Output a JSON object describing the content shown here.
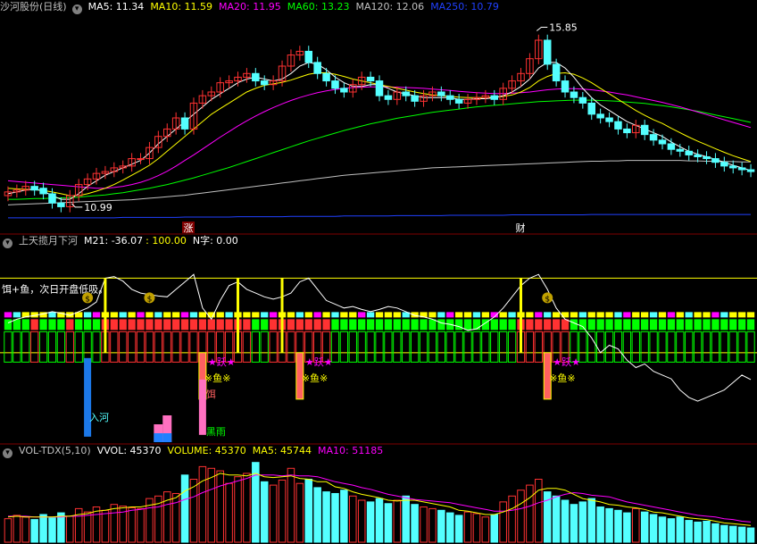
{
  "panel_main": {
    "title": "沙河股份(日线)",
    "ma": [
      {
        "label": "MA5: 11.34",
        "color": "#ffffff"
      },
      {
        "label": "MA10: 11.59",
        "color": "#ffff00"
      },
      {
        "label": "MA20: 11.95",
        "color": "#ff00ff"
      },
      {
        "label": "MA60: 13.23",
        "color": "#00ff00"
      },
      {
        "label": "MA120: 12.06",
        "color": "#c0c0c0"
      },
      {
        "label": "MA250: 10.79",
        "color": "#2040ff"
      }
    ],
    "high_label": "15.85",
    "low_label": "10.99",
    "marker1": "涨",
    "marker2": "财"
  },
  "panel_ind": {
    "title": "上天揽月下河",
    "m21": "M21: -36.07",
    "v100": ": 100.00",
    "nzi": "N字: 0.00",
    "note": "饵+鱼，次日开盘低吸。",
    "tag_enter": "入河",
    "tag_jump": "★跃★",
    "tag_fish": "※鱼※",
    "tag_bait": "饵",
    "tag_rain": "黑雨",
    "bag": "$"
  },
  "panel_vol": {
    "title": "VOL-TDX(5,10)",
    "vvol": "VVOL: 45370",
    "volume": "VOLUME: 45370",
    "ma5": "MA5: 45744",
    "ma10": "MA10: 51185"
  },
  "colors": {
    "up": "#ff3232",
    "down": "#54ffff",
    "green": "#00ff00",
    "yellow": "#ffff00",
    "magenta": "#ff00ff",
    "blue": "#2040ff"
  },
  "chart_data": {
    "type": "candlestick",
    "price": {
      "open": [
        11.3,
        11.4,
        11.45,
        11.55,
        11.5,
        11.35,
        11.1,
        11.0,
        11.3,
        11.6,
        11.75,
        11.9,
        11.95,
        12.05,
        12.1,
        12.3,
        12.3,
        12.6,
        12.9,
        13.1,
        13.4,
        13.1,
        13.8,
        14.0,
        14.1,
        14.35,
        14.4,
        14.5,
        14.6,
        14.4,
        14.3,
        14.4,
        14.8,
        15.1,
        15.2,
        14.9,
        14.6,
        14.4,
        14.2,
        14.1,
        14.3,
        14.5,
        14.4,
        14.0,
        13.9,
        14.1,
        14.0,
        13.85,
        14.0,
        14.1,
        14.0,
        13.9,
        13.8,
        13.9,
        13.95,
        14.0,
        13.9,
        14.2,
        14.4,
        14.6,
        15.0,
        15.5,
        14.85,
        14.4,
        14.1,
        13.95,
        13.8,
        13.5,
        13.4,
        13.3,
        13.1,
        13.0,
        13.2,
        12.95,
        12.8,
        12.7,
        12.55,
        12.5,
        12.4,
        12.35,
        12.3,
        12.2,
        12.1,
        12.05,
        12.0
      ],
      "close": [
        11.4,
        11.45,
        11.55,
        11.45,
        11.35,
        11.1,
        11.0,
        11.3,
        11.6,
        11.75,
        11.9,
        11.95,
        12.05,
        12.1,
        12.3,
        12.3,
        12.6,
        12.9,
        13.1,
        13.4,
        13.1,
        13.8,
        14.0,
        14.1,
        14.35,
        14.4,
        14.5,
        14.6,
        14.4,
        14.3,
        14.4,
        14.8,
        15.1,
        15.2,
        14.9,
        14.6,
        14.4,
        14.2,
        14.1,
        14.3,
        14.5,
        14.4,
        14.0,
        13.9,
        14.1,
        14.0,
        13.85,
        14.0,
        14.1,
        14.0,
        13.9,
        13.8,
        13.9,
        13.95,
        14.0,
        13.9,
        14.2,
        14.4,
        14.6,
        15.0,
        15.5,
        14.85,
        14.4,
        14.1,
        13.95,
        13.8,
        13.5,
        13.4,
        13.3,
        13.1,
        13.0,
        13.2,
        12.95,
        12.8,
        12.7,
        12.55,
        12.5,
        12.4,
        12.35,
        12.3,
        12.2,
        12.1,
        12.05,
        12.0,
        11.95
      ],
      "high_label": 15.85,
      "low_label": 10.99,
      "ylim": [
        10.6,
        16.2
      ]
    },
    "ma5": [
      11.35,
      11.4,
      11.45,
      11.48,
      11.42,
      11.3,
      11.2,
      11.2,
      11.35,
      11.55,
      11.7,
      11.85,
      11.95,
      12.05,
      12.15,
      12.25,
      12.45,
      12.7,
      12.9,
      13.1,
      13.3,
      13.5,
      13.7,
      13.9,
      14.05,
      14.2,
      14.35,
      14.45,
      14.5,
      14.45,
      14.4,
      14.45,
      14.6,
      14.8,
      14.9,
      14.85,
      14.7,
      14.5,
      14.35,
      14.25,
      14.25,
      14.3,
      14.3,
      14.2,
      14.1,
      14.05,
      14.0,
      13.95,
      13.95,
      13.95,
      13.95,
      13.9,
      13.9,
      13.92,
      13.92,
      13.95,
      14.0,
      14.1,
      14.25,
      14.45,
      14.75,
      14.9,
      14.9,
      14.75,
      14.5,
      14.2,
      13.95,
      13.75,
      13.6,
      13.45,
      13.3,
      13.2,
      13.1,
      13.0,
      12.9,
      12.75,
      12.62,
      12.5,
      12.42,
      12.35,
      12.28,
      12.2,
      12.12,
      12.05,
      11.98
    ],
    "ma10": [
      11.5,
      11.48,
      11.47,
      11.46,
      11.44,
      11.4,
      11.35,
      11.3,
      11.3,
      11.35,
      11.42,
      11.5,
      11.6,
      11.72,
      11.85,
      11.98,
      12.12,
      12.3,
      12.5,
      12.7,
      12.9,
      13.1,
      13.3,
      13.5,
      13.65,
      13.8,
      13.95,
      14.1,
      14.2,
      14.28,
      14.32,
      14.36,
      14.42,
      14.5,
      14.58,
      14.62,
      14.62,
      14.58,
      14.52,
      14.45,
      14.4,
      14.35,
      14.3,
      14.25,
      14.2,
      14.15,
      14.1,
      14.06,
      14.02,
      14.0,
      13.98,
      13.96,
      13.95,
      13.95,
      13.95,
      13.96,
      13.98,
      14.02,
      14.1,
      14.22,
      14.4,
      14.52,
      14.6,
      14.62,
      14.58,
      14.48,
      14.35,
      14.2,
      14.05,
      13.9,
      13.75,
      13.6,
      13.47,
      13.35,
      13.25,
      13.12,
      13.0,
      12.88,
      12.77,
      12.67,
      12.57,
      12.47,
      12.38,
      12.3,
      12.22
    ],
    "ma20": [
      11.7,
      11.68,
      11.66,
      11.64,
      11.62,
      11.6,
      11.58,
      11.56,
      11.54,
      11.52,
      11.5,
      11.5,
      11.52,
      11.55,
      11.6,
      11.66,
      11.74,
      11.84,
      11.96,
      12.1,
      12.25,
      12.4,
      12.56,
      12.72,
      12.88,
      13.03,
      13.18,
      13.32,
      13.45,
      13.57,
      13.68,
      13.78,
      13.87,
      13.95,
      14.02,
      14.08,
      14.13,
      14.17,
      14.2,
      14.22,
      14.23,
      14.24,
      14.24,
      14.24,
      14.23,
      14.22,
      14.21,
      14.2,
      14.18,
      14.16,
      14.14,
      14.12,
      14.1,
      14.08,
      14.07,
      14.06,
      14.06,
      14.07,
      14.08,
      14.1,
      14.13,
      14.16,
      14.18,
      14.19,
      14.19,
      14.18,
      14.16,
      14.13,
      14.1,
      14.06,
      14.02,
      13.97,
      13.92,
      13.87,
      13.82,
      13.76,
      13.7,
      13.63,
      13.56,
      13.49,
      13.42,
      13.35,
      13.28,
      13.21,
      13.14
    ],
    "ma60": [
      11.2,
      11.2,
      11.21,
      11.22,
      11.22,
      11.23,
      11.24,
      11.25,
      11.26,
      11.28,
      11.3,
      11.32,
      11.35,
      11.38,
      11.42,
      11.46,
      11.5,
      11.55,
      11.6,
      11.66,
      11.72,
      11.78,
      11.85,
      11.92,
      11.99,
      12.06,
      12.14,
      12.22,
      12.3,
      12.38,
      12.46,
      12.54,
      12.62,
      12.7,
      12.78,
      12.85,
      12.92,
      12.99,
      13.06,
      13.12,
      13.18,
      13.24,
      13.29,
      13.34,
      13.39,
      13.43,
      13.47,
      13.51,
      13.55,
      13.58,
      13.61,
      13.64,
      13.67,
      13.7,
      13.72,
      13.74,
      13.76,
      13.78,
      13.8,
      13.82,
      13.84,
      13.85,
      13.86,
      13.87,
      13.88,
      13.88,
      13.88,
      13.87,
      13.86,
      13.85,
      13.83,
      13.81,
      13.79,
      13.76,
      13.73,
      13.7,
      13.66,
      13.62,
      13.58,
      13.53,
      13.48,
      13.43,
      13.38,
      13.33,
      13.28
    ],
    "ma120": [
      11.05,
      11.06,
      11.07,
      11.08,
      11.09,
      11.1,
      11.11,
      11.12,
      11.13,
      11.14,
      11.15,
      11.16,
      11.17,
      11.18,
      11.19,
      11.21,
      11.23,
      11.25,
      11.27,
      11.29,
      11.31,
      11.34,
      11.37,
      11.4,
      11.43,
      11.46,
      11.49,
      11.52,
      11.55,
      11.58,
      11.61,
      11.64,
      11.67,
      11.7,
      11.73,
      11.76,
      11.79,
      11.82,
      11.85,
      11.87,
      11.89,
      11.91,
      11.93,
      11.95,
      11.97,
      11.99,
      12.01,
      12.03,
      12.05,
      12.06,
      12.07,
      12.08,
      12.09,
      12.1,
      12.11,
      12.12,
      12.13,
      12.14,
      12.15,
      12.16,
      12.17,
      12.18,
      12.19,
      12.2,
      12.21,
      12.22,
      12.23,
      12.23,
      12.24,
      12.24,
      12.25,
      12.25,
      12.25,
      12.25,
      12.25,
      12.25,
      12.25,
      12.24,
      12.24,
      12.23,
      12.23,
      12.22,
      12.22,
      12.21,
      12.21
    ],
    "ma250": [
      10.7,
      10.7,
      10.7,
      10.7,
      10.7,
      10.7,
      10.7,
      10.7,
      10.7,
      10.7,
      10.7,
      10.7,
      10.7,
      10.71,
      10.71,
      10.71,
      10.71,
      10.71,
      10.71,
      10.71,
      10.72,
      10.72,
      10.72,
      10.72,
      10.72,
      10.72,
      10.73,
      10.73,
      10.73,
      10.73,
      10.73,
      10.73,
      10.74,
      10.74,
      10.74,
      10.74,
      10.74,
      10.74,
      10.75,
      10.75,
      10.75,
      10.75,
      10.75,
      10.75,
      10.76,
      10.76,
      10.76,
      10.76,
      10.76,
      10.76,
      10.77,
      10.77,
      10.77,
      10.77,
      10.77,
      10.77,
      10.77,
      10.78,
      10.78,
      10.78,
      10.78,
      10.78,
      10.78,
      10.78,
      10.78,
      10.78,
      10.79,
      10.79,
      10.79,
      10.79,
      10.79,
      10.79,
      10.79,
      10.79,
      10.79,
      10.79,
      10.79,
      10.79,
      10.79,
      10.79,
      10.79,
      10.79,
      10.79,
      10.79,
      10.79
    ],
    "volume": [
      28,
      32,
      30,
      27,
      33,
      29,
      35,
      31,
      40,
      36,
      42,
      38,
      45,
      43,
      41,
      40,
      52,
      55,
      60,
      58,
      80,
      75,
      90,
      88,
      85,
      70,
      78,
      82,
      95,
      72,
      68,
      74,
      88,
      70,
      75,
      65,
      60,
      58,
      62,
      55,
      50,
      48,
      52,
      46,
      50,
      55,
      45,
      42,
      40,
      38,
      35,
      32,
      36,
      34,
      30,
      33,
      48,
      55,
      62,
      68,
      75,
      60,
      55,
      50,
      45,
      48,
      52,
      42,
      40,
      38,
      35,
      40,
      36,
      33,
      30,
      28,
      30,
      26,
      24,
      25,
      22,
      20,
      19,
      18,
      17
    ],
    "vol_ma5": [
      30,
      31,
      30,
      30,
      30,
      30,
      31,
      31,
      33,
      34,
      37,
      38,
      40,
      41,
      42,
      42,
      44,
      46,
      50,
      53,
      61,
      66,
      73,
      77,
      82,
      80,
      80,
      79,
      82,
      78,
      77,
      78,
      79,
      76,
      75,
      72,
      72,
      66,
      64,
      60,
      57,
      55,
      53,
      50,
      49,
      50,
      50,
      48,
      46,
      44,
      42,
      38,
      37,
      35,
      33,
      33,
      36,
      40,
      46,
      53,
      62,
      64,
      64,
      62,
      57,
      52,
      50,
      48,
      45,
      44,
      42,
      41,
      39,
      36,
      35,
      33,
      31,
      29,
      28,
      27,
      25,
      23,
      22,
      21,
      20
    ],
    "vol_ma10": [
      31,
      31,
      31,
      30,
      30,
      30,
      30,
      31,
      31,
      32,
      33,
      34,
      35,
      36,
      38,
      39,
      41,
      42,
      45,
      47,
      51,
      54,
      59,
      63,
      67,
      70,
      73,
      76,
      80,
      80,
      80,
      79,
      80,
      79,
      79,
      78,
      75,
      72,
      70,
      68,
      65,
      63,
      60,
      57,
      55,
      53,
      51,
      50,
      49,
      48,
      47,
      45,
      43,
      41,
      39,
      37,
      37,
      38,
      40,
      43,
      47,
      50,
      54,
      57,
      59,
      58,
      56,
      55,
      54,
      51,
      48,
      46,
      44,
      42,
      40,
      38,
      36,
      34,
      32,
      31,
      30,
      28,
      27,
      25,
      24
    ],
    "m21_line": [
      40,
      45,
      48,
      50,
      52,
      55,
      53,
      50,
      55,
      60,
      68,
      100,
      102,
      96,
      85,
      80,
      78,
      76,
      75,
      85,
      95,
      105,
      60,
      45,
      70,
      90,
      95,
      85,
      80,
      75,
      72,
      75,
      80,
      95,
      100,
      85,
      70,
      65,
      60,
      62,
      58,
      55,
      58,
      62,
      60,
      55,
      50,
      48,
      45,
      40,
      38,
      35,
      30,
      32,
      40,
      48,
      60,
      75,
      90,
      100,
      105,
      85,
      60,
      45,
      40,
      35,
      20,
      0,
      10,
      5,
      -10,
      -20,
      -15,
      -25,
      -30,
      -35,
      -50,
      -60,
      -65,
      -60,
      -55,
      -50,
      -40,
      -30,
      -36
    ]
  }
}
